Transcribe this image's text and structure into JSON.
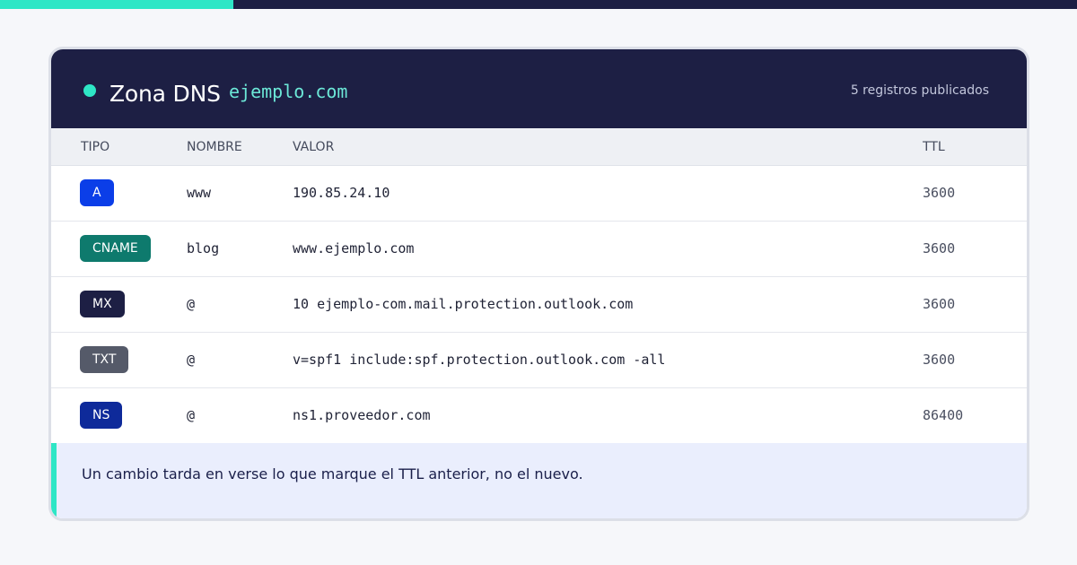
{
  "colors": {
    "accent": "#2ee6c6",
    "header_bg": "#1d1f44",
    "page_bg": "#f6f7fa"
  },
  "progress": {
    "fraction": 0.217
  },
  "header": {
    "label": "Zona DNS",
    "domain": "ejemplo.com",
    "count": "5 registros publicados"
  },
  "table": {
    "columns": [
      "TIPO",
      "NOMBRE",
      "VALOR",
      "TTL"
    ],
    "rows": [
      {
        "type": "A",
        "type_color": "#0b3ee8",
        "name": "www",
        "value": "190.85.24.10",
        "ttl": "3600"
      },
      {
        "type": "CNAME",
        "type_color": "#0e7a6d",
        "name": "blog",
        "value": "www.ejemplo.com",
        "ttl": "3600"
      },
      {
        "type": "MX",
        "type_color": "#1d1f44",
        "name": "@",
        "value": "10 ejemplo-com.mail.protection.outlook.com",
        "ttl": "3600"
      },
      {
        "type": "TXT",
        "type_color": "#555a69",
        "name": "@",
        "value": "v=spf1 include:spf.protection.outlook.com -all",
        "ttl": "3600"
      },
      {
        "type": "NS",
        "type_color": "#0e2a9a",
        "name": "@",
        "value": "ns1.proveedor.com",
        "ttl": "86400"
      }
    ]
  },
  "note": "Un cambio tarda en verse lo que marque el TTL anterior, no el nuevo."
}
